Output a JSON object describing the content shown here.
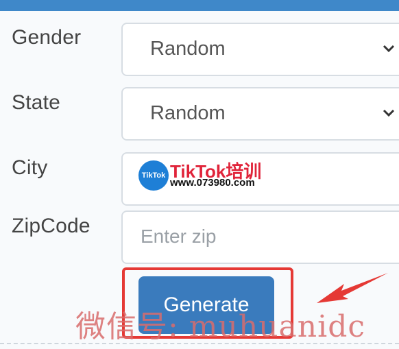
{
  "form": {
    "gender": {
      "label": "Gender",
      "value": "Random"
    },
    "state": {
      "label": "State",
      "value": "Random"
    },
    "city": {
      "label": "City",
      "value": ""
    },
    "zipcode": {
      "label": "ZipCode",
      "placeholder": "Enter zip",
      "value": ""
    }
  },
  "actions": {
    "generate_label": "Generate"
  },
  "watermark": {
    "logo_text": "TikTok",
    "title": "TikTok培训",
    "url": "www.073980.com",
    "overlay": "微信号: muhuanidc"
  },
  "colors": {
    "header": "#3f88c9",
    "button": "#3a7bbd",
    "highlight": "#e53935"
  }
}
